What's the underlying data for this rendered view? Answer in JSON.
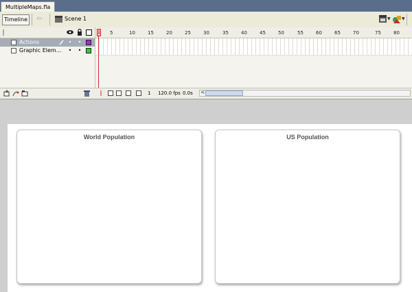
{
  "document_tab": "MultipleMaps.fla",
  "toolbar": {
    "timeline_button": "Timeline",
    "back_arrow": "⇦",
    "scene_label": "Scene 1"
  },
  "layers_header": {
    "eye": "●",
    "lock": "🔒"
  },
  "layers": [
    {
      "name": "Actions",
      "selected": true,
      "color": "#9b30c8"
    },
    {
      "name": "Graphic Elem...",
      "selected": false,
      "color": "#33cc33"
    }
  ],
  "ruler": {
    "playhead": "1",
    "ticks": [
      "5",
      "10",
      "15",
      "20",
      "25",
      "30",
      "35",
      "40",
      "45",
      "50",
      "55",
      "60",
      "65",
      "70",
      "75",
      "80"
    ]
  },
  "status": {
    "current_frame": "1",
    "frame_rate": "120.0 fps",
    "elapsed_time": "0.0s",
    "scroll_left": "<"
  },
  "panels": [
    {
      "title": "World Population"
    },
    {
      "title": "US Population"
    }
  ],
  "colors": {
    "tab_bar": "#5a6e8c",
    "playhead": "#d62a2a",
    "selection": "#a5acb7"
  }
}
